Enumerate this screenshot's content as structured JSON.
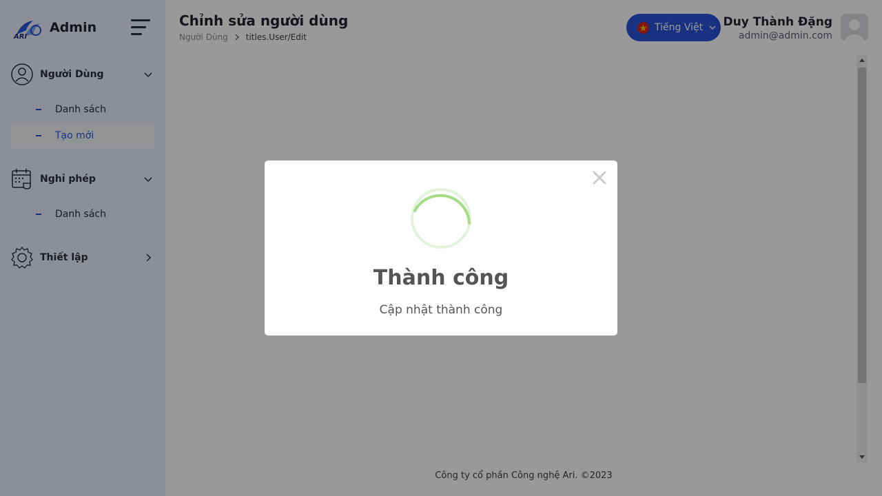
{
  "app": {
    "brand": "Admin"
  },
  "sidebar": {
    "groups": [
      {
        "label": "Người Dùng",
        "icon": "user-circle-icon",
        "expanded": true,
        "items": [
          {
            "label": "Danh sách",
            "active": false
          },
          {
            "label": "Tạo mới",
            "active": true
          }
        ]
      },
      {
        "label": "Nghỉ phép",
        "icon": "calendar-icon",
        "expanded": true,
        "items": [
          {
            "label": "Danh sách",
            "active": false
          }
        ]
      },
      {
        "label": "Thiết lập",
        "icon": "gear-icon",
        "expanded": false,
        "items": []
      }
    ]
  },
  "header": {
    "title": "Chỉnh sửa người dùng",
    "breadcrumb": [
      "Người Dùng",
      "titles.User/Edit"
    ],
    "language": "Tiếng Việt",
    "user": {
      "name": "Duy Thành Đặng",
      "email": "admin@admin.com"
    }
  },
  "footer": {
    "text": "Công ty cổ phần Công nghệ Ari. ©2023"
  },
  "modal": {
    "title": "Thành công",
    "message": "Cập nhật thành công"
  },
  "colors": {
    "accent": "#2a52d8",
    "sidebar_bg": "#e9eefc",
    "success": "#a5dc86"
  }
}
